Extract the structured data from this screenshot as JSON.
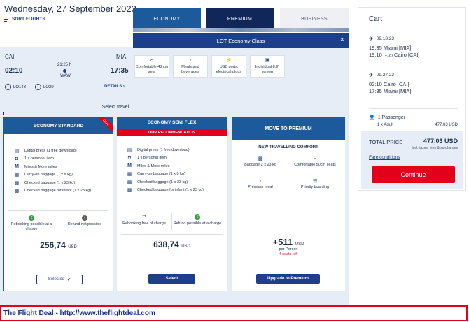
{
  "header": {
    "date": "Wednesday, 27 September 2023",
    "sort_label": "SORT FLIGHTS"
  },
  "tabs": [
    {
      "label": "ECONOMY"
    },
    {
      "label": "PREMIUM"
    },
    {
      "label": "BUSINESS"
    }
  ],
  "flight": {
    "origin": "CAI",
    "destination": "MIA",
    "depart_time": "02:10",
    "arrive_time": "17:35",
    "duration": "21:25 h",
    "stop": "WAW",
    "flight1": "LO148",
    "flight2": "LO29",
    "details": "DETAILS"
  },
  "overlay": {
    "title": "LOT Economy Class",
    "close": "×",
    "amenities": [
      {
        "icon": "seat-icon",
        "glyph": "⌐",
        "label": "Comfortable 43 cm seat"
      },
      {
        "icon": "meal-icon",
        "glyph": "♆",
        "label": "Meals and beverages"
      },
      {
        "icon": "usb-icon",
        "glyph": "⚡",
        "label": "USB ports, electrical plugs"
      },
      {
        "icon": "screen-icon",
        "glyph": "▣",
        "label": "Individual 8.9\" screen"
      }
    ]
  },
  "select_travel": "Select travel",
  "cards": {
    "standard": {
      "title": "ECONOMY STANDARD",
      "ribbon": "DEAL",
      "features": [
        {
          "glyph": "▤",
          "text": "Digital press (1 free download)"
        },
        {
          "glyph": "◘",
          "text": "1 x personal item"
        },
        {
          "glyph": "M",
          "text": "Miles & More miles"
        },
        {
          "glyph": "▦",
          "text": "Carry-on baggage (1 x 8 kg)"
        },
        {
          "glyph": "▩",
          "text": "Checked baggage (1 x 23 kg)"
        },
        {
          "glyph": "▩",
          "text": "Checked baggage for infant (1 x 23 kg)"
        }
      ],
      "cond1": "Rebooking possible at a charge",
      "cond2": "Refund not possible",
      "price": "256,74",
      "currency": "USD",
      "button": "Selected",
      "check": "✔"
    },
    "semi": {
      "title": "ECONOMY SEMI FLEX",
      "badge": "OUR RECOMMENDATION",
      "features": [
        {
          "glyph": "▤",
          "text": "Digital press (1 free download)"
        },
        {
          "glyph": "◘",
          "text": "1 x personal item"
        },
        {
          "glyph": "M",
          "text": "Miles & More miles"
        },
        {
          "glyph": "▦",
          "text": "Carry-on baggage (1 x 8 kg)"
        },
        {
          "glyph": "▩",
          "text": "Checked baggage (1 x 23 kg)"
        },
        {
          "glyph": "▩",
          "text": "Checked baggage for infant (1 x 23 kg)"
        }
      ],
      "cond1": "Rebooking free of charge",
      "cond2": "Refund possible at a charge",
      "price": "638,74",
      "currency": "USD",
      "button": "Select"
    },
    "premium": {
      "title": "MOVE TO PREMIUM",
      "subtitle": "NEW TRAVELLING COMFORT",
      "features": [
        {
          "glyph": "▩",
          "text": "Baggage 2 x 23 kg"
        },
        {
          "glyph": "⌐",
          "text": "Comfortable 50cm seats"
        },
        {
          "glyph": "♆",
          "text": "Premium meal"
        },
        {
          "glyph": "⇶",
          "text": "Priority boarding"
        }
      ],
      "price": "+511",
      "currency": "USD",
      "per": "per Person",
      "seats": "4 seats left",
      "button": "Upgrade to Premium"
    }
  },
  "cart": {
    "title": "Cart",
    "seg1": {
      "date": "09.18.23",
      "dep_time": "19:35",
      "dep_city": "Miami [MIA]",
      "arr_time": "19:10",
      "plus": "(+1d)",
      "arr_city": "Cairo [CAI]"
    },
    "seg2": {
      "date": "09.27.23",
      "dep_time": "02:10",
      "dep_city": "Cairo [CAI]",
      "arr_time": "17:35",
      "arr_city": "Miami [MIA]"
    },
    "passengers": "1 Passenger",
    "adult": "1 x  Adult",
    "adult_price": "477,03 USD",
    "total_label": "TOTAL PRICE",
    "total_value": "477,03 USD",
    "total_note": "Incl. taxes, fees & surcharges",
    "fare_conditions": "Fare conditions",
    "continue": "Continue"
  },
  "footer": "The Flight Deal - http://www.theflightdeal.com"
}
